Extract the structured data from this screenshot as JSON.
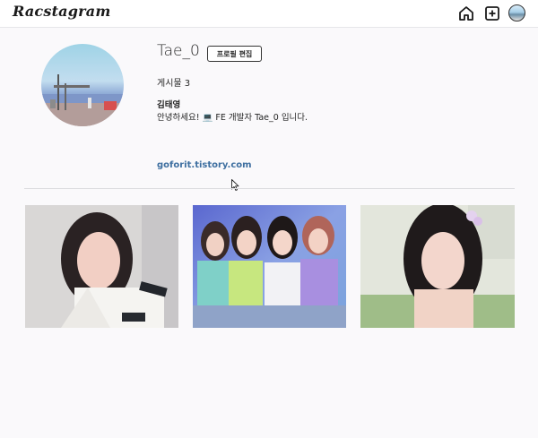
{
  "header": {
    "logo": "Racstagram",
    "icons": [
      "home-icon",
      "new-post-icon",
      "profile-avatar-icon"
    ]
  },
  "profile": {
    "username": "Tae_0",
    "edit_button_label": "프로필 편집",
    "posts_label": "게시물 3",
    "real_name": "김태영",
    "bio": "안녕하세요! 💻 FE 개발자 Tae_0 입니다.",
    "link": "goforit.tistory.com"
  },
  "posts": [
    {
      "alt": "post-photo-1"
    },
    {
      "alt": "post-photo-2"
    },
    {
      "alt": "post-photo-3"
    }
  ],
  "colors": {
    "link": "#3e6fa0",
    "background": "#faf9fb",
    "topbar": "#ffffff"
  }
}
